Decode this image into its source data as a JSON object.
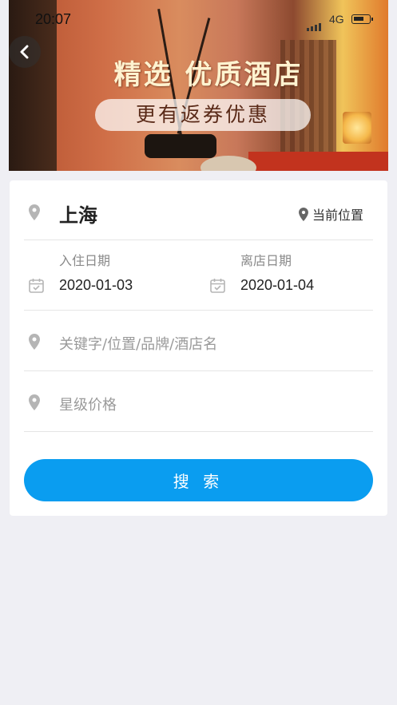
{
  "status_bar": {
    "time": "20:07",
    "network": "4G"
  },
  "banner": {
    "title": "精选 优质酒店",
    "subtitle": "更有返券优惠"
  },
  "search_form": {
    "city": "上海",
    "current_location_label": "当前位置",
    "checkin": {
      "label": "入住日期",
      "value": "2020-01-03"
    },
    "checkout": {
      "label": "离店日期",
      "value": "2020-01-04"
    },
    "keyword_placeholder": "关键字/位置/品牌/酒店名",
    "star_price_placeholder": "星级价格",
    "search_button": "搜 索"
  },
  "colors": {
    "accent": "#0a9df0",
    "background": "#efeff4",
    "icon_gray": "#b5b5b5"
  },
  "icons": [
    "back-arrow-icon",
    "location-pin-icon",
    "calendar-icon"
  ]
}
